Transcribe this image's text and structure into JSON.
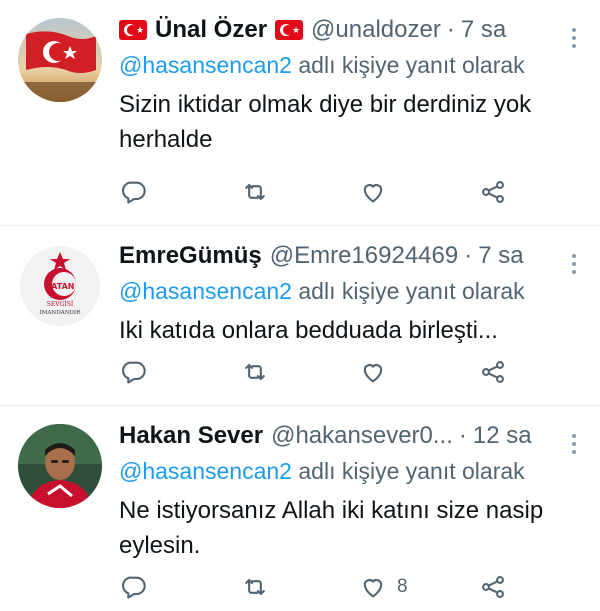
{
  "tweets": [
    {
      "name": "Ünal Özer",
      "handle": "@unaldozer",
      "time": "7 sa",
      "reply_mention": "@hasansencan2",
      "reply_suffix": "adlı kişiye yanıt olarak",
      "text": "Sizin iktidar olmak diye bir derdiniz yok herhalde",
      "like_count": ""
    },
    {
      "name": "EmreGümüş",
      "handle": "@Emre16924469",
      "time": "7 sa",
      "reply_mention": "@hasansencan2",
      "reply_suffix": "adlı kişiye yanıt olarak",
      "text": "Iki katıda onlara bedduada birleşti...",
      "avatar_text_top": "VATAN",
      "avatar_text_mid": "SEVGİSİ",
      "avatar_text_bottom": "İMANDANDIR",
      "like_count": ""
    },
    {
      "name": "Hakan Sever",
      "handle": "@hakansever0...",
      "time": "12 sa",
      "reply_mention": "@hasansencan2",
      "reply_suffix": "adlı kişiye yanıt olarak",
      "text": "Ne istiyorsanız Allah iki katını size nasip eylesin.",
      "like_count": "8"
    }
  ],
  "colors": {
    "link": "#1d9bf0",
    "secondary_text": "#536471",
    "flag_red": "#e30a17"
  },
  "icons": [
    "reply-icon",
    "retweet-icon",
    "like-icon",
    "share-icon",
    "more-icon"
  ]
}
